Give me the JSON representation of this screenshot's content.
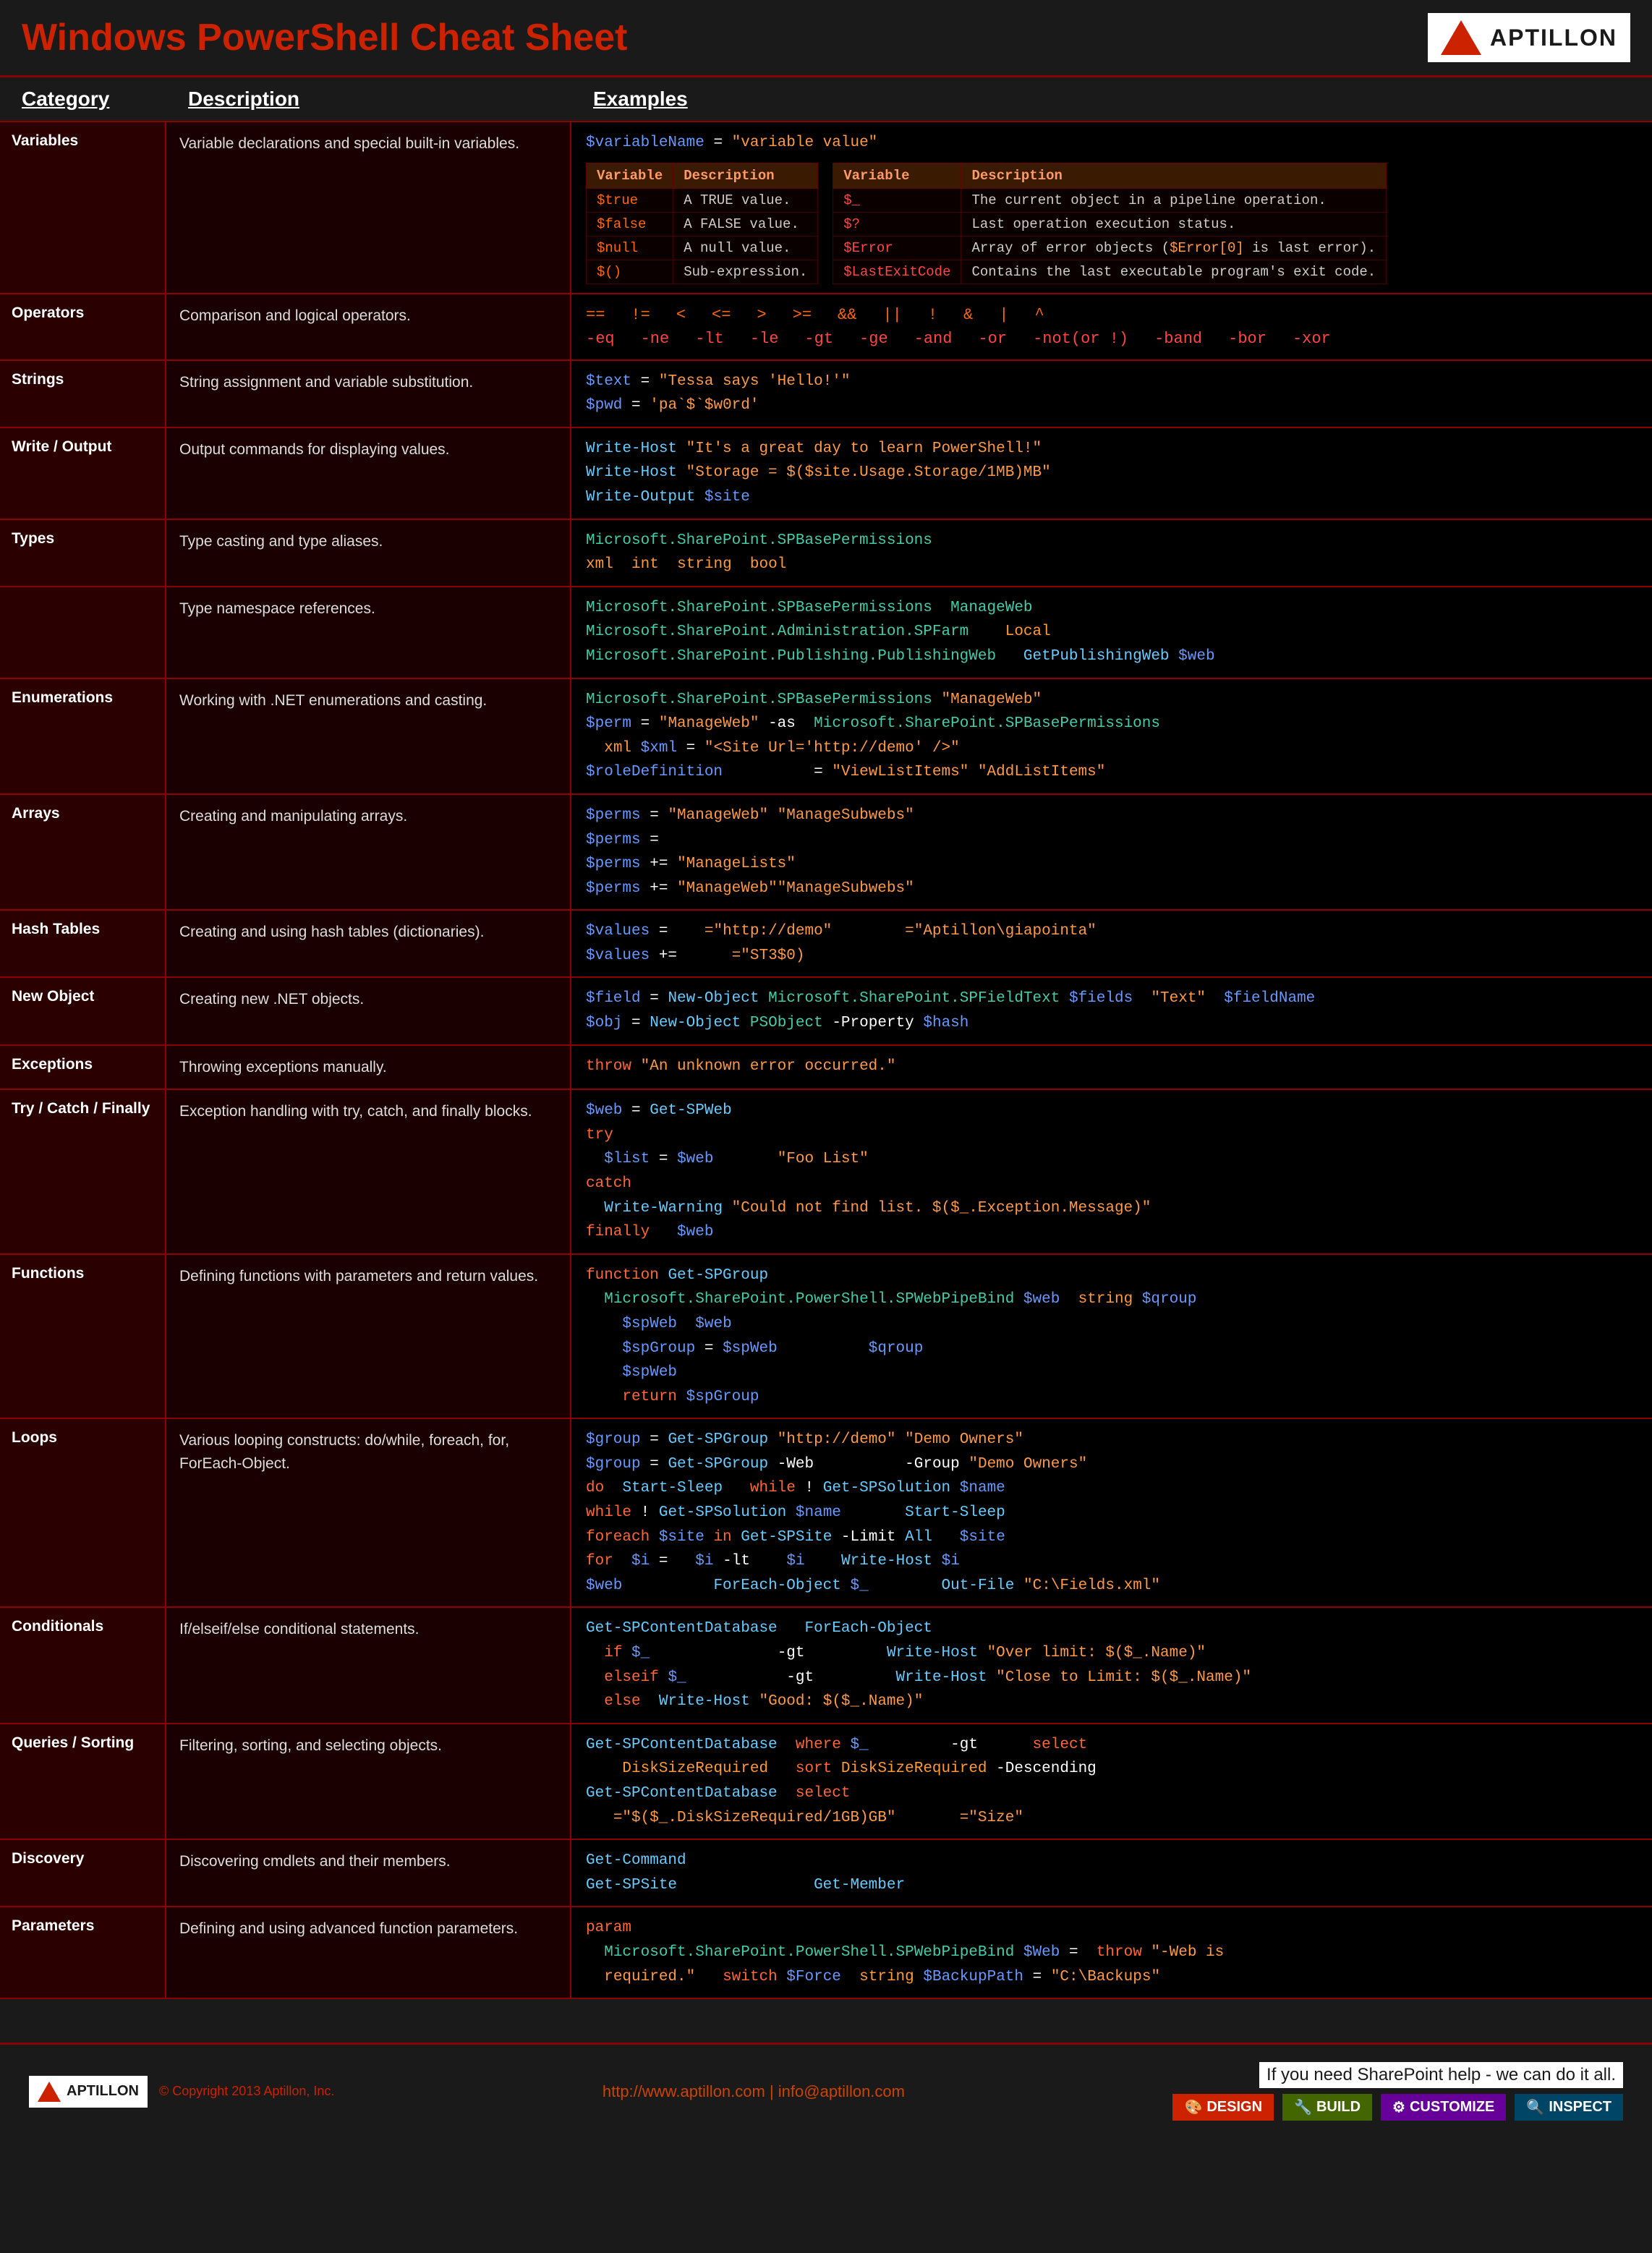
{
  "header": {
    "title": "Windows PowerShell Cheat Sheet",
    "logo_text": "APTILLON"
  },
  "columns": {
    "category": "Category",
    "description": "Description",
    "examples": "Examples"
  },
  "sections": [
    {
      "id": "variables",
      "category": "",
      "description": "",
      "type": "variables"
    },
    {
      "id": "operators",
      "category": "",
      "description": "",
      "type": "operators"
    },
    {
      "id": "strings",
      "category": "",
      "description": "",
      "type": "strings"
    },
    {
      "id": "write",
      "category": "",
      "description": "",
      "type": "write"
    },
    {
      "id": "types1",
      "category": "",
      "description": "",
      "type": "types1"
    },
    {
      "id": "types2",
      "category": "",
      "description": "",
      "type": "types2"
    },
    {
      "id": "enum",
      "category": "",
      "description": "",
      "type": "enum"
    },
    {
      "id": "arrays",
      "category": "",
      "description": "",
      "type": "arrays"
    },
    {
      "id": "hashtable",
      "category": "",
      "description": "",
      "type": "hashtable"
    },
    {
      "id": "newobj",
      "category": "",
      "description": "",
      "type": "newobj"
    },
    {
      "id": "exceptions",
      "category": "",
      "description": "",
      "type": "exceptions"
    },
    {
      "id": "trycatch",
      "category": "",
      "description": "",
      "type": "trycatch"
    },
    {
      "id": "functions",
      "category": "",
      "description": "",
      "type": "functions"
    },
    {
      "id": "loops",
      "category": "",
      "description": "",
      "type": "loops"
    },
    {
      "id": "conditionals",
      "category": "",
      "description": "",
      "type": "conditionals"
    },
    {
      "id": "queries",
      "category": "",
      "description": "",
      "type": "queries"
    },
    {
      "id": "getcommand",
      "category": "",
      "description": "",
      "type": "getcommand"
    },
    {
      "id": "params",
      "category": "",
      "description": "",
      "type": "params"
    }
  ],
  "footer": {
    "logo_text": "APTILLON",
    "copyright": "© Copyright 2013 Aptillon, Inc.",
    "links": "http://www.aptillon.com  |  info@aptillon.com",
    "tagline": "If you need SharePoint help - we can do it all.",
    "badges": [
      "DESIGN",
      "BUILD",
      "CUSTOMIZE",
      "INSPECT"
    ]
  }
}
